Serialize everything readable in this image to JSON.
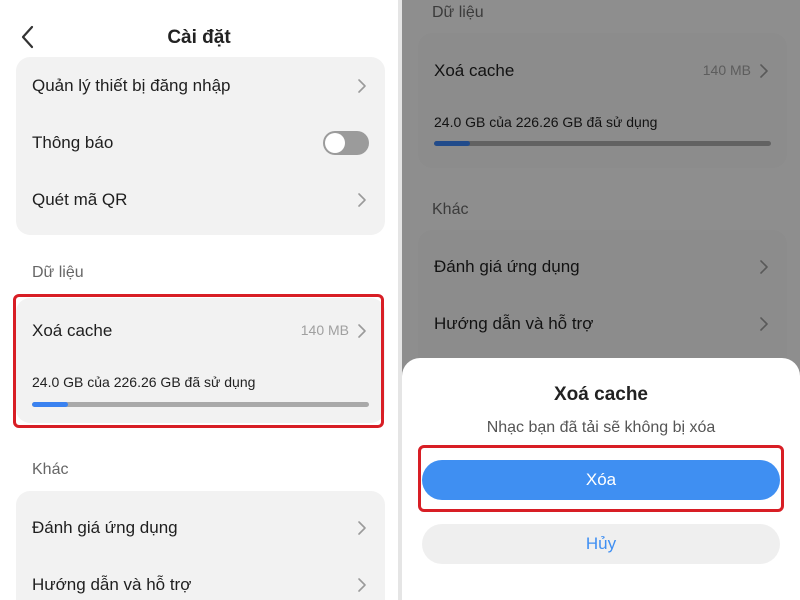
{
  "left": {
    "title": "Cài đặt",
    "rows_top": [
      {
        "label": "Quản lý thiết bị đăng nhập"
      },
      {
        "label": "Thông báo"
      },
      {
        "label": "Quét mã QR"
      }
    ],
    "data_section": {
      "label": "Dữ liệu",
      "clear_cache_label": "Xoá cache",
      "cache_size": "140 MB",
      "usage_text": "24.0 GB của 226.26 GB đã sử dụng",
      "usage_fraction": 0.106
    },
    "other_section": {
      "label": "Khác",
      "rows": [
        {
          "label": "Đánh giá ứng dụng"
        },
        {
          "label": "Hướng dẫn và hỗ trợ"
        }
      ]
    }
  },
  "right": {
    "data_section": {
      "label": "Dữ liệu",
      "clear_cache_label": "Xoá cache",
      "cache_size": "140 MB",
      "usage_text": "24.0 GB của 226.26 GB đã sử dụng",
      "usage_fraction": 0.106
    },
    "other_section": {
      "label": "Khác",
      "rows": [
        {
          "label": "Đánh giá ứng dụng"
        },
        {
          "label": "Hướng dẫn và hỗ trợ"
        }
      ]
    },
    "dialog": {
      "title": "Xoá cache",
      "message": "Nhạc bạn đã tải sẽ không bị xóa",
      "confirm_label": "Xóa",
      "cancel_label": "Hủy"
    }
  },
  "colors": {
    "accent": "#3f8ff2",
    "highlight": "#d81e25",
    "progress_fill": "#3a82f0"
  },
  "notifications_toggle": false
}
